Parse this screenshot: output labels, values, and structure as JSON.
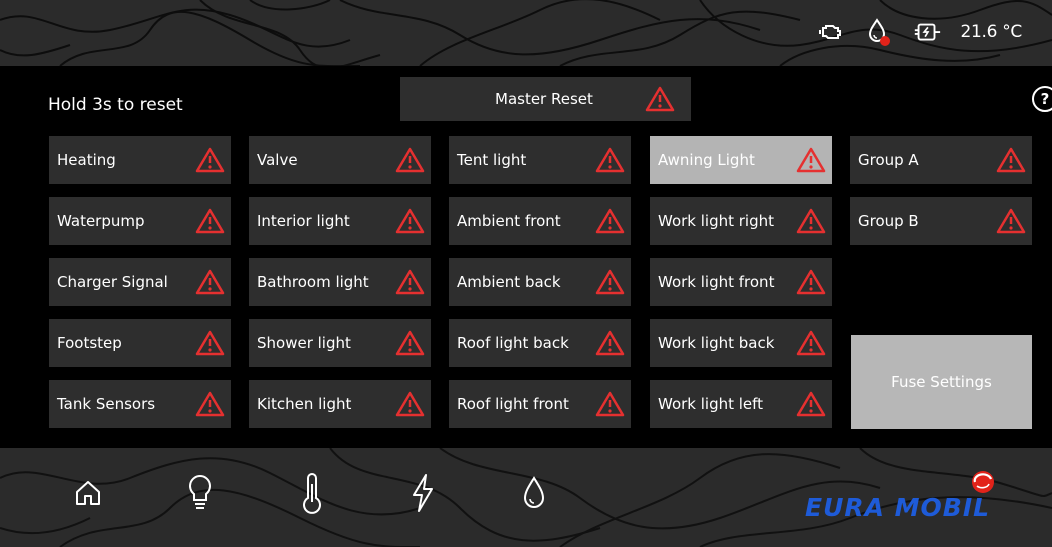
{
  "status": {
    "temperature": "21.6 °C",
    "icons": [
      "engine-icon",
      "water-drop-alert-icon",
      "battery-charging-icon"
    ]
  },
  "main": {
    "reset_hint": "Hold 3s to reset",
    "master_reset_label": "Master Reset",
    "help_label": "?",
    "fuse_settings_label": "Fuse Settings",
    "columns": [
      [
        "Heating",
        "Waterpump",
        "Charger Signal",
        "Footstep",
        "Tank Sensors"
      ],
      [
        "Valve",
        "Interior light",
        "Bathroom light",
        "Shower light",
        "Kitchen light"
      ],
      [
        "Tent light",
        "Ambient front",
        "Ambient back",
        "Roof light back",
        "Roof light front"
      ],
      [
        "Awning Light",
        "Work light right",
        "Work light front",
        "Work light back",
        "Work light left"
      ],
      [
        "Group A",
        "Group B"
      ]
    ],
    "active_tile": "Awning Light"
  },
  "nav": {
    "items": [
      "home-icon",
      "lightbulb-icon",
      "thermometer-icon",
      "lightning-icon",
      "water-drop-icon"
    ]
  },
  "brand": {
    "name": "EURA MOBIL",
    "color": "#1e5bd8",
    "accent": "#e2231a"
  },
  "colors": {
    "warning": "#e53030",
    "tile": "#2e2e2e",
    "tile_active": "#b4b4b4"
  }
}
